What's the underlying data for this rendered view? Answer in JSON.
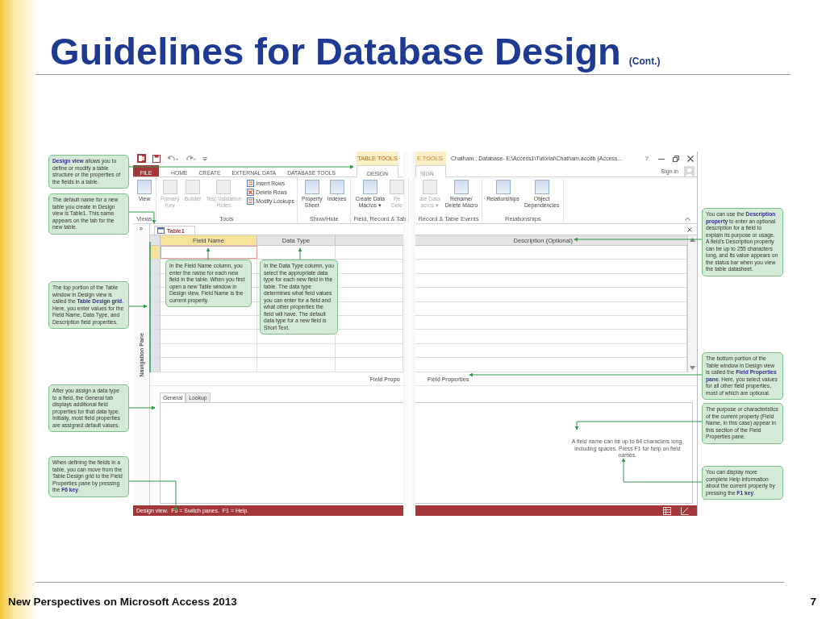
{
  "slide": {
    "title": "Guidelines for Database Design",
    "title_note": "(Cont.)",
    "footer": "New Perspectives on Microsoft Access 2013",
    "page_number": "7"
  },
  "window": {
    "context_label": "TABLE TOOLS",
    "context_label_cut": "E TOOLS",
    "title": "Chatham : Database- E:\\Access1\\Tutorial\\Chatham.accdb (Access...",
    "help": "?",
    "sign_in": "Sign in"
  },
  "tabs": [
    {
      "label": "FILE",
      "kind": "file",
      "selected": false
    },
    {
      "label": "HOME",
      "kind": "tab",
      "selected": false
    },
    {
      "label": "CREATE",
      "kind": "tab",
      "selected": false
    },
    {
      "label": "EXTERNAL DATA",
      "kind": "tab",
      "selected": false
    },
    {
      "label": "DATABASE TOOLS",
      "kind": "tab",
      "selected": false
    },
    {
      "label": "DESIGN",
      "kind": "tab",
      "selected": true
    }
  ],
  "tabs_cut": [
    {
      "label": "SIGN",
      "selected": true
    }
  ],
  "ribbon_left": [
    {
      "label": "Views",
      "buttons": [
        {
          "lines": [
            "View"
          ],
          "kind": "large",
          "disabled": false
        }
      ]
    },
    {
      "label": "Tools",
      "buttons": [
        {
          "lines": [
            "Primary",
            "Key"
          ],
          "kind": "large",
          "disabled": true
        },
        {
          "lines": [
            "Builder"
          ],
          "kind": "large",
          "disabled": true
        },
        {
          "lines": [
            "Test Validation",
            "Rules"
          ],
          "kind": "large",
          "disabled": true
        },
        {
          "lines": [
            "Insert Rows"
          ],
          "kind": "small",
          "disabled": false
        },
        {
          "lines": [
            "Delete Rows"
          ],
          "kind": "small",
          "disabled": false
        },
        {
          "lines": [
            "Modify Lookups"
          ],
          "kind": "small",
          "disabled": false
        }
      ]
    },
    {
      "label": "Show/Hide",
      "buttons": [
        {
          "lines": [
            "Property",
            "Sheet"
          ],
          "kind": "large",
          "disabled": false
        },
        {
          "lines": [
            "Indexes"
          ],
          "kind": "large",
          "disabled": false
        }
      ]
    },
    {
      "label": "Field, Record & Tab",
      "buttons": [
        {
          "lines": [
            "Create Data",
            "Macros ▾"
          ],
          "kind": "large",
          "disabled": false
        },
        {
          "lines": [
            "Re",
            "Dele"
          ],
          "kind": "large",
          "disabled": true
        }
      ]
    }
  ],
  "ribbon_right": [
    {
      "label": "Record & Table Events",
      "buttons": [
        {
          "lines": [
            "ate Data",
            "acros ▾"
          ],
          "kind": "large",
          "disabled": true
        },
        {
          "lines": [
            "Rename/",
            "Delete Macro"
          ],
          "kind": "large",
          "disabled": false
        }
      ]
    },
    {
      "label": "Relationships",
      "buttons": [
        {
          "lines": [
            "Relationships"
          ],
          "kind": "large",
          "disabled": false
        },
        {
          "lines": [
            "Object",
            "Dependencies"
          ],
          "kind": "large",
          "disabled": false
        }
      ]
    }
  ],
  "document": {
    "tab": "Table1",
    "nav_toggle": "»",
    "nav_label": "Navigation Pane",
    "columns": [
      "Field Name",
      "Data Type",
      "Description (Optional)"
    ],
    "field_properties_cut": "Field Propo",
    "field_properties": "Field Properties",
    "property_tabs": [
      {
        "label": "General",
        "selected": true
      },
      {
        "label": "Lookup",
        "selected": false
      }
    ],
    "help_text": "A field name can be up to 64 characters long, including spaces. Press F1 for help on field names.",
    "status": "Design view.  F6 = Switch panes.  F1 = Help."
  },
  "callouts": [
    {
      "text": "**Design view** allows you to define or modify a table structure or the properties of the fields in a table."
    },
    {
      "text": "The default name for a new table you create in Design view is Table1. This name appears on the tab for the new table."
    },
    {
      "text": "The top portion of the Table window in Design view is called the **Table Design grid**. Here, you enter values for the Field Name, Data Type, and Description field properties."
    },
    {
      "text": "After you assign a data type to a field, the General tab displays additional field properties for that data type. Initially, most field properties are assigned default values."
    },
    {
      "text": "When defining the fields in a table, you can move from the Table Design grid to the Field Properties pane by pressing the **F6 key**."
    },
    {
      "text": "In the Field Name column, you enter the name for each new field in the table. When you first open a new Table window in Design view, Field Name is the current property."
    },
    {
      "text": "In the Data Type column, you select the appropriate data type for each new field in the table. The data type determines what field values you can enter for a field and what other properties the field will have. The default data type for a new field is Short Text."
    },
    {
      "text": "You can use the **Description property** to enter an optional description for a field to explain its purpose or usage. A field’s Description property can be up to 255 characters long, and its value appears on the status bar when you view the table datasheet."
    },
    {
      "text": "The bottom portion of the Table window in Design view is called the **Field Properties pane**. Here, you select values for all other field properties, most of which are optional."
    },
    {
      "text": "The purpose or characteristics of the current property (Field Name, in this case) appear in this section of the Field Properties pane."
    },
    {
      "text": "You can display more complete Help information about the current property by pressing the **F1 key**."
    }
  ]
}
